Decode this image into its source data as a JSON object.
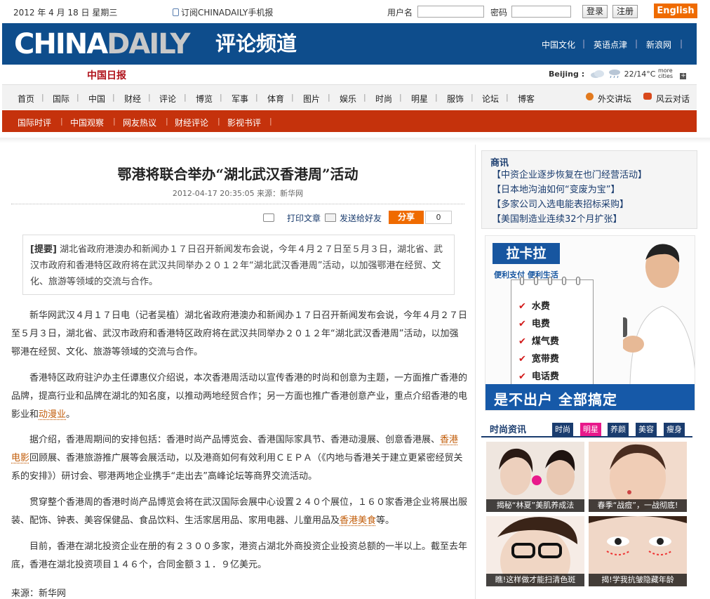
{
  "topbar": {
    "date": "2012 年 4 月 18 日 星期三",
    "subscribe": "订阅CHINADAILY手机报",
    "username_label": "用户名",
    "password_label": "密码",
    "login": "登录",
    "register": "注册",
    "english": "English"
  },
  "banner": {
    "logo_a": "CHINA",
    "logo_b": "DAILY",
    "channel": "评论频道",
    "links": [
      "中国文化",
      "英语点津",
      "新浪网"
    ],
    "sep": "|"
  },
  "subbanner": {
    "cn_logo": "中国日报",
    "city": "Beijing :",
    "temp": "22/14°C",
    "more": "more cities"
  },
  "nav": {
    "items": [
      "首页",
      "国际",
      "中国",
      "财经",
      "评论",
      "博览",
      "军事",
      "体育",
      "图片",
      "娱乐",
      "时尚",
      "明星",
      "服饰",
      "论坛",
      "博客"
    ],
    "extra": [
      "外交讲坛",
      "风云对话"
    ],
    "sub": [
      "国际时评",
      "中国观察",
      "网友热议",
      "财经评论",
      "影视书评"
    ],
    "sep": "|"
  },
  "article": {
    "title": "鄂港将联合举办“湖北武汉香港周”活动",
    "meta": "2012-04-17 20:35:05  来源：新华网",
    "print": "打印文章",
    "send": "发送给好友",
    "share": "分享",
    "share_count": "0",
    "summary_label": "[提要]",
    "summary": "湖北省政府港澳办和新闻办１７日召开新闻发布会说，今年４月２７日至５月３日，湖北省、武汉市政府和香港特区政府将在武汉共同举办２０１２年“湖北武汉香港周”活动，以加强鄂港在经贸、文化、旅游等领域的交流与合作。",
    "p1": "新华网武汉４月１７日电（记者吴植）湖北省政府港澳办和新闻办１７日召开新闻发布会说，今年４月２７日至５月３日，湖北省、武汉市政府和香港特区政府将在武汉共同举办２０１２年“湖北武汉香港周”活动，以加强鄂港在经贸、文化、旅游等领域的交流与合作。",
    "p2a": "香港特区政府驻沪办主任谭惠仪介绍说，本次香港周活动以宣传香港的时尚和创意为主题，一方面推广香港的品牌，提高行业和品牌在湖北的知名度，以推动两地经贸合作；另一方面也推广香港创意产业，重点介绍香港的电影业和",
    "p2link": "动漫业",
    "p2b": "。",
    "p3a": "据介绍，香港周期间的安排包括：香港时尚产品博览会、香港国际家具节、香港动漫展、创意香港展、",
    "p3link": "香港电影",
    "p3b": "回顾展、香港旅游推广展等会展活动，以及港商如何有效利用ＣＥＰＡ（《内地与香港关于建立更紧密经贸关系的安排》）研讨会、鄂港两地企业携手“走出去”高峰论坛等商界交流活动。",
    "p4a": "贯穿整个香港周的香港时尚产品博览会将在武汉国际会展中心设置２４０个展位，１６０家香港企业将展出服装、配饰、钟表、美容保健品、食品饮料、生活家居用品、家用电器、儿童用品及",
    "p4link": "香港美食",
    "p4b": "等。",
    "p5": "目前，香港在湖北投资企业在册的有２３００多家，港资占湖北外商投资企业投资总额的一半以上。截至去年底，香港在湖北投资项目１４６个，合同金额３１．９亿美元。",
    "source": "来源：新华网"
  },
  "sidebar": {
    "news_header": "商讯",
    "news": [
      "【中资企业逐步恢复在也门经营活动】",
      "【日本地沟油如何“变废为宝”】",
      "【多家公司入选电能表招标采购】",
      "【美国制造业连续32个月扩张】"
    ],
    "ad_brand": "拉卡拉",
    "ad_slogan": "便利支付  便利生活",
    "ad_items": [
      "水费",
      "电费",
      "煤气费",
      "宽带费",
      "电话费"
    ],
    "ad_bottom": "是不出户  全部搞定",
    "fashion_header": "时尚资讯",
    "fashion_tabs": [
      "时尚",
      "明星",
      "养颜",
      "美容",
      "瘦身"
    ],
    "captions": [
      "揭秘“林夏”美肌养成法",
      "春季“战痘”，一战彻底!",
      "瞧!这样做才能扫清色斑",
      "揭!学我抗皱隐藏年龄"
    ]
  },
  "colors": {
    "blue": "#0e4d8c",
    "red": "#c5320c",
    "orange": "#ef6b00",
    "pink": "#e8198b"
  }
}
